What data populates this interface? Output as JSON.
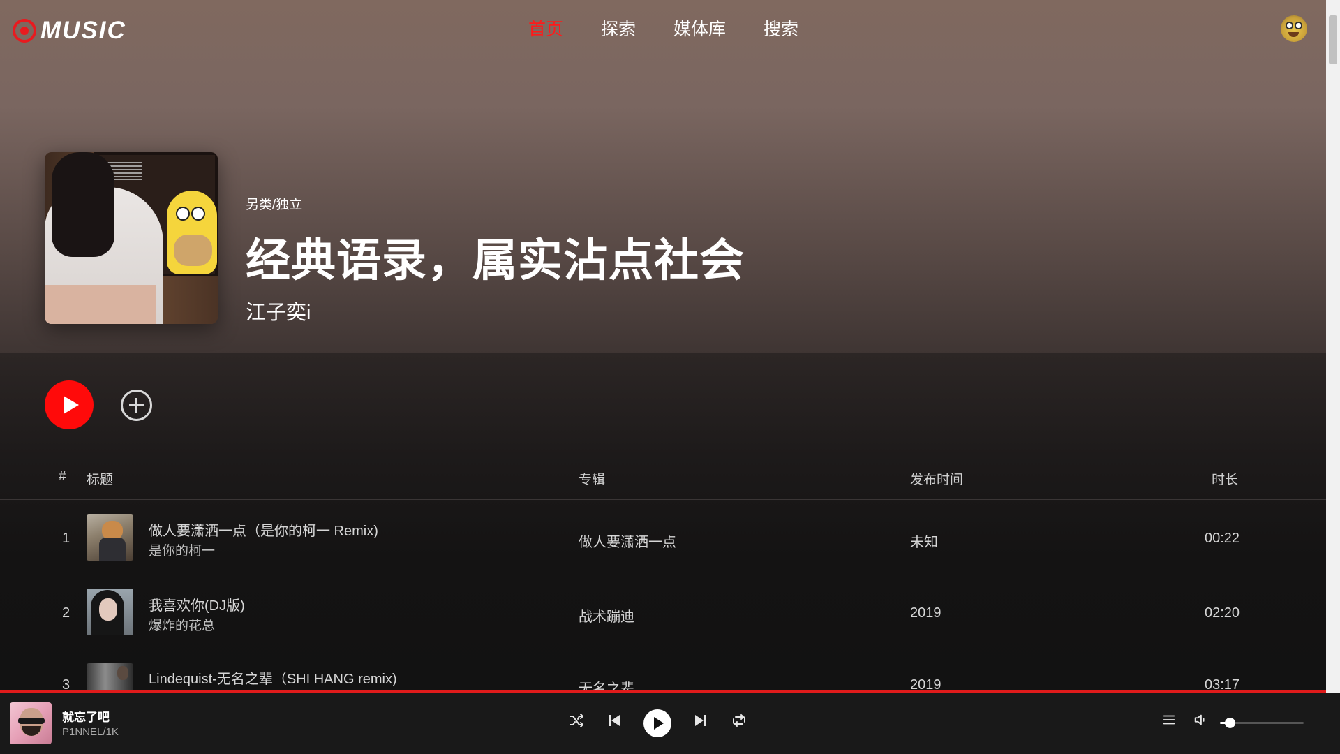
{
  "brand": {
    "logo_text": "MUSIC",
    "accent": "#ff1a1a"
  },
  "nav": {
    "items": [
      {
        "label": "首页",
        "active": true
      },
      {
        "label": "探索",
        "active": false
      },
      {
        "label": "媒体库",
        "active": false
      },
      {
        "label": "搜索",
        "active": false
      }
    ]
  },
  "album": {
    "genre": "另类/独立",
    "title": "经典语录，属实沾点社会",
    "artist": "江子奕i"
  },
  "table": {
    "headers": {
      "index": "#",
      "title": "标题",
      "album": "专辑",
      "release": "发布时间",
      "duration": "时长"
    },
    "rows": [
      {
        "index": "1",
        "title": "做人要潇洒一点（是你的柯一 Remix)",
        "artist": "是你的柯一",
        "album": "做人要潇洒一点",
        "release": "未知",
        "duration": "00:22"
      },
      {
        "index": "2",
        "title": "我喜欢你(DJ版)",
        "artist": "爆炸的花总",
        "album": "战术蹦迪",
        "release": "2019",
        "duration": "02:20"
      },
      {
        "index": "3",
        "title": "Lindequist-无名之辈（SHI HANG remix)",
        "artist": "",
        "album": "无名之辈",
        "release": "2019",
        "duration": "03:17"
      }
    ]
  },
  "player": {
    "now_playing_title": "就忘了吧",
    "now_playing_artist": "P1NNEL/1K",
    "volume": 0.12,
    "icons": [
      "shuffle-icon",
      "previous-icon",
      "play-icon",
      "next-icon",
      "repeat-icon",
      "queue-icon",
      "volume-icon"
    ]
  }
}
